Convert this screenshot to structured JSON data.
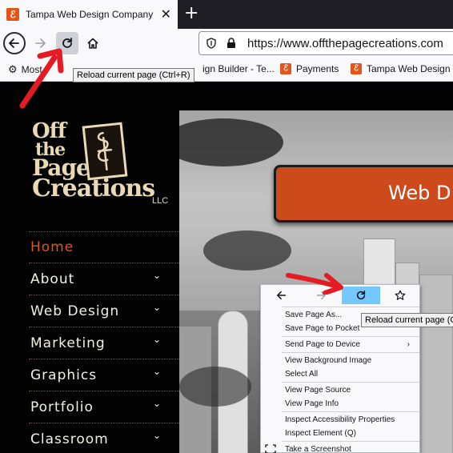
{
  "tab": {
    "title": "Tampa Web Design Company | ",
    "close": "✕",
    "new_tab": "+"
  },
  "navbar": {
    "url": "https://www.offthepagecreations.com"
  },
  "bookmarks": {
    "items": [
      {
        "label": "Most"
      },
      {
        "label": "ign Builder - Te..."
      },
      {
        "label": "Payments"
      },
      {
        "label": "Tampa Web Design C"
      }
    ]
  },
  "tooltips": {
    "reload": "Reload current page (Ctrl+R)",
    "reload_ctx": "Reload current page (Ct"
  },
  "site": {
    "logo": {
      "line1": "Off",
      "line2": "the",
      "line3": "Page",
      "line4": "Creations",
      "llc": ", LLC"
    },
    "menu": [
      {
        "label": "Home",
        "active": true,
        "has_submenu": false
      },
      {
        "label": "About",
        "active": false,
        "has_submenu": true
      },
      {
        "label": "Web Design",
        "active": false,
        "has_submenu": true
      },
      {
        "label": "Marketing",
        "active": false,
        "has_submenu": true
      },
      {
        "label": "Graphics",
        "active": false,
        "has_submenu": true
      },
      {
        "label": "Portfolio",
        "active": false,
        "has_submenu": true
      },
      {
        "label": "Classroom",
        "active": false,
        "has_submenu": true
      }
    ],
    "banner_text": "Web D"
  },
  "context_menu": {
    "items": {
      "save_page_as": "Save Page As...",
      "save_to_pocket": "Save Page to Pocket",
      "send_to_device": "Send Page to Device",
      "view_bg_image": "View Background Image",
      "select_all": "Select All",
      "view_source": "View Page Source",
      "view_info": "View Page Info",
      "inspect_a11y": "Inspect Accessibility Properties",
      "inspect_element": "Inspect Element (Q)",
      "screenshot": "Take a Screenshot"
    }
  },
  "colors": {
    "accent_orange": "#e2541a",
    "annotation_red": "#e41b23",
    "ctx_highlight": "#75c7ff"
  }
}
